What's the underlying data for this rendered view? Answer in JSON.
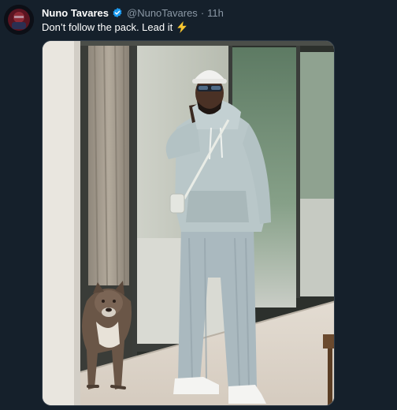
{
  "tweet": {
    "author_name": "Nuno Tavares",
    "handle": "@NunoTavares",
    "separator": "·",
    "time": "11h",
    "text": "Don’t follow the pack. Lead it",
    "text_emoji": "lightning-icon"
  },
  "colors": {
    "background": "#15202b",
    "secondary_text": "#8b98a5",
    "verified_badge": "#1d9bf0",
    "emoji": "#f7c631"
  }
}
